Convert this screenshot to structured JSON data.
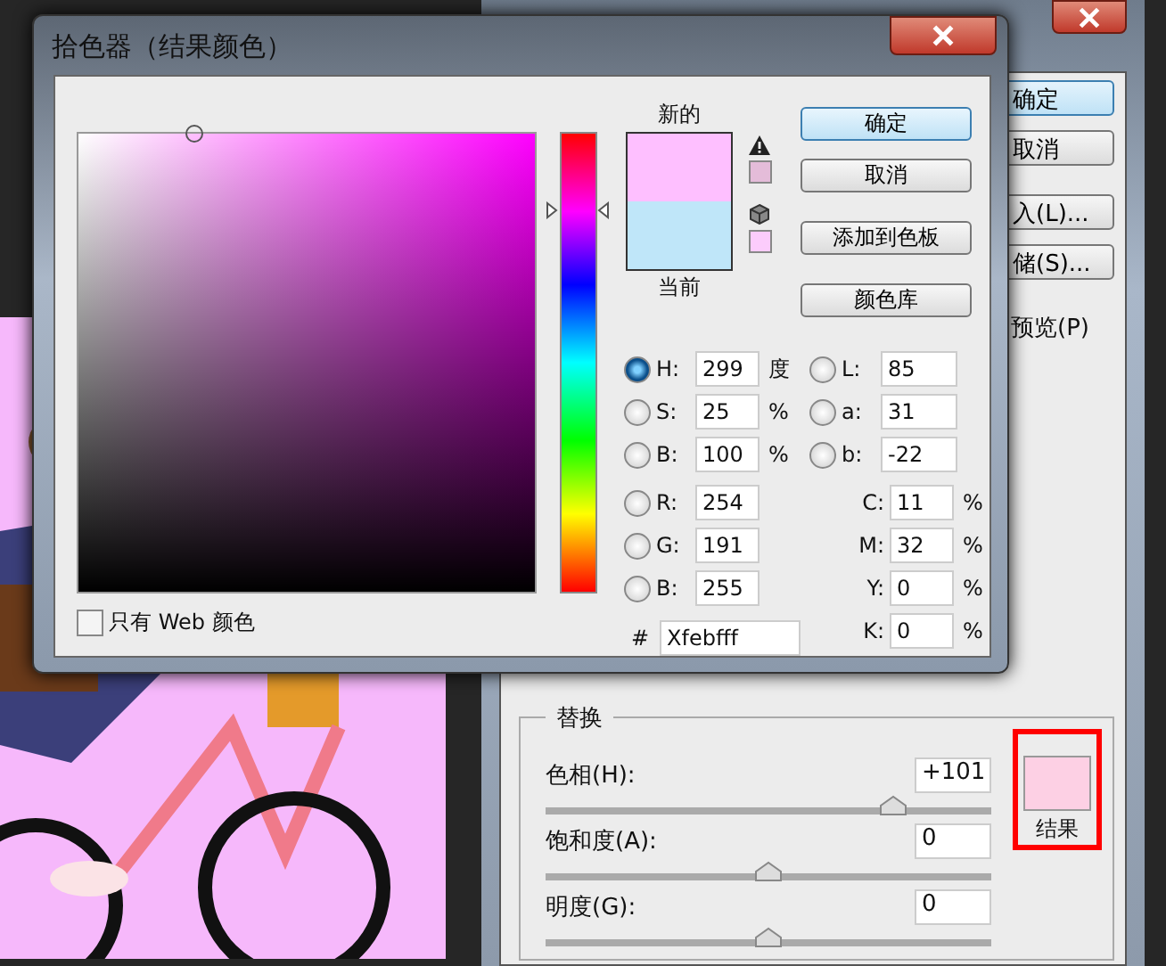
{
  "back_dialog": {
    "buttons": [
      {
        "label": "确定",
        "default": true
      },
      {
        "label": "取消",
        "default": false
      },
      {
        "label": "入(L)...",
        "default": false
      },
      {
        "label": "储(S)...",
        "default": false
      }
    ],
    "preview_label": "预览(P)",
    "replace": {
      "title": "替换",
      "sliders": [
        {
          "label": "色相(H):",
          "value": "+101",
          "level": 0.78
        },
        {
          "label": "饱和度(A):",
          "value": "0",
          "level": 0.5
        },
        {
          "label": "明度(G):",
          "value": "0",
          "level": 0.5
        }
      ],
      "result_label": "结果"
    }
  },
  "picker": {
    "title": "拾色器（结果颜色）",
    "hue": {
      "level": 0.83
    },
    "new_label": "新的",
    "current_label": "当前",
    "web_only": {
      "label": "只有 Web 颜色",
      "checked": false
    },
    "buttons": [
      {
        "label": "确定",
        "default": true
      },
      {
        "label": "取消",
        "default": false
      },
      {
        "label": "添加到色板",
        "default": false
      },
      {
        "label": "颜色库",
        "default": false
      }
    ],
    "rows": [
      {
        "left": {
          "kind": "radio",
          "label": "H:",
          "value": "299",
          "unit": "度",
          "selected": true
        },
        "right": {
          "kind": "radio",
          "label": "L:",
          "value": "85",
          "selected": false
        }
      },
      {
        "left": {
          "kind": "radio",
          "label": "S:",
          "value": "25",
          "unit": "%",
          "selected": false
        },
        "right": {
          "kind": "radio",
          "label": "a:",
          "value": "31",
          "selected": false
        }
      },
      {
        "left": {
          "kind": "radio",
          "label": "B:",
          "value": "100",
          "unit": "%",
          "selected": false
        },
        "right": {
          "kind": "radio",
          "label": "b:",
          "value": "-22",
          "selected": false
        }
      },
      {
        "left": {
          "kind": "radio",
          "label": "R:",
          "value": "254",
          "selected": false
        },
        "right": {
          "kind": "plain",
          "label": "C:",
          "value": "11",
          "unit": "%"
        }
      },
      {
        "left": {
          "kind": "radio",
          "label": "G:",
          "value": "191",
          "selected": false
        },
        "right": {
          "kind": "plain",
          "label": "M:",
          "value": "32",
          "unit": "%"
        }
      },
      {
        "left": {
          "kind": "radio",
          "label": "B:",
          "value": "255",
          "selected": false
        },
        "right": {
          "kind": "plain",
          "label": "Y:",
          "value": "0",
          "unit": "%"
        }
      },
      {
        "left": {
          "kind": "hex",
          "label": "#",
          "value": "Xfebfff"
        },
        "right": {
          "kind": "plain",
          "label": "K:",
          "value": "0",
          "unit": "%"
        }
      }
    ]
  }
}
